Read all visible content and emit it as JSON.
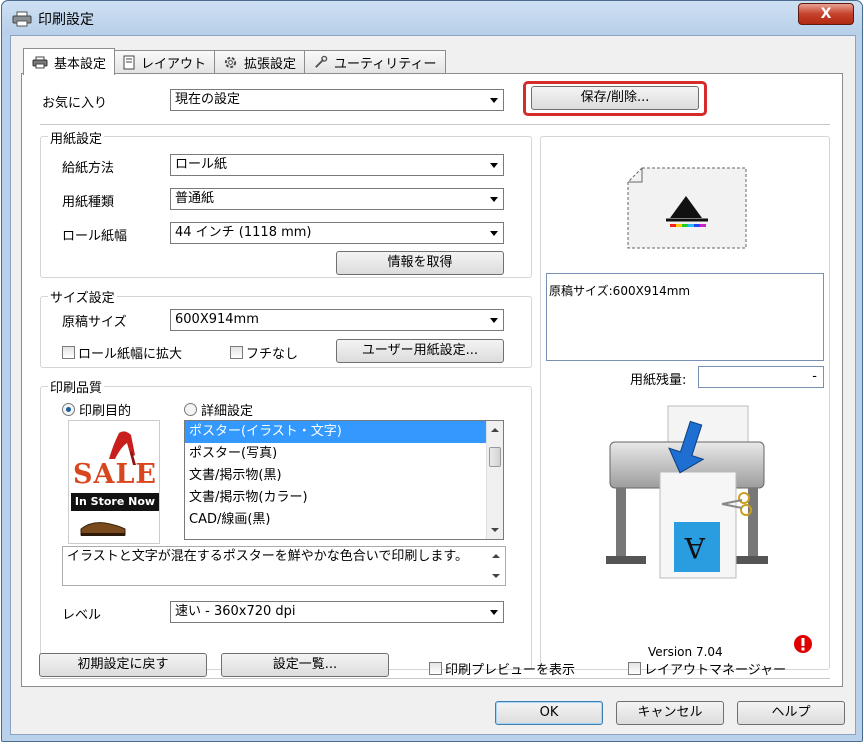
{
  "window": {
    "title": "印刷設定",
    "close_label": "X"
  },
  "tabs": [
    {
      "label": "基本設定",
      "icon": "printer-icon"
    },
    {
      "label": "レイアウト",
      "icon": "page-icon"
    },
    {
      "label": "拡張設定",
      "icon": "gear-icon"
    },
    {
      "label": "ユーティリティー",
      "icon": "wrench-icon"
    }
  ],
  "favorites": {
    "label": "お気に入り",
    "value": "現在の設定",
    "save_button": "保存/削除..."
  },
  "paper": {
    "group_title": "用紙設定",
    "source_label": "給紙方法",
    "source_value": "ロール紙",
    "type_label": "用紙種類",
    "type_value": "普通紙",
    "width_label": "ロール紙幅",
    "width_value": "44 インチ (1118 mm)",
    "get_info_button": "情報を取得"
  },
  "size": {
    "group_title": "サイズ設定",
    "doc_size_label": "原稿サイズ",
    "doc_size_value": "600X914mm",
    "enlarge_checkbox": "ロール紙幅に拡大",
    "borderless_checkbox": "フチなし",
    "custom_paper_button": "ユーザー用紙設定..."
  },
  "quality": {
    "group_title": "印刷品質",
    "radio_purpose": "印刷目的",
    "radio_advanced": "詳細設定",
    "thumbnail": {
      "sale_text": "SALE",
      "store_text": "In Store Now"
    },
    "purpose_list": [
      "ポスター(イラスト・文字)",
      "ポスター(写真)",
      "文書/掲示物(黒)",
      "文書/掲示物(カラー)",
      "CAD/線画(黒)"
    ],
    "selected_index": 0,
    "description": "イラストと文字が混在するポスターを鮮やかな色合いで印刷します。",
    "level_label": "レベル",
    "level_value": "速い - 360x720 dpi"
  },
  "preview": {
    "doc_size_text": "原稿サイズ:600X914mm",
    "remaining_label": "用紙残量:",
    "remaining_value": "-",
    "version": "Version 7.04"
  },
  "footer": {
    "reset_button": "初期設定に戻す",
    "settings_list_button": "設定一覧...",
    "print_preview_checkbox": "印刷プレビューを表示",
    "layout_manager_checkbox": "レイアウトマネージャー"
  },
  "dialog_buttons": {
    "ok": "OK",
    "cancel": "キャンセル",
    "help": "ヘルプ"
  },
  "colors": {
    "highlight": "#d42b2b",
    "selection": "#3399ff",
    "title_bar": "#b9d1ea",
    "alert": "#e00000"
  }
}
